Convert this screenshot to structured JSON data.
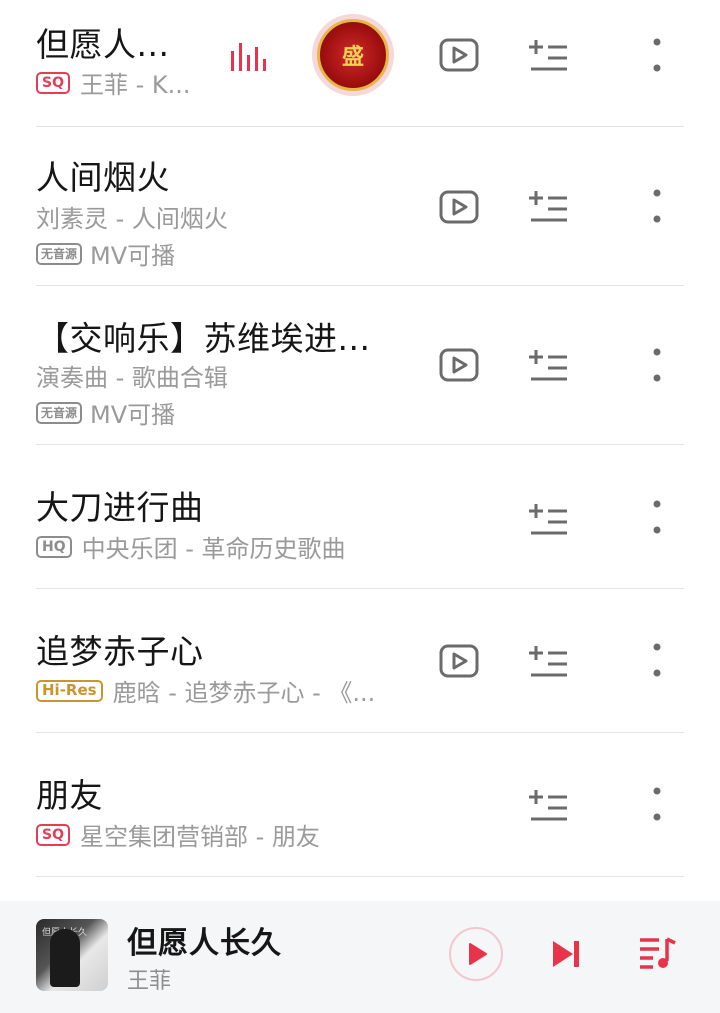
{
  "songs": [
    {
      "title": "但愿人...",
      "badge": "SQ",
      "badge_type": "sq",
      "subtitle": "王菲 - K...",
      "playing": true,
      "has_mv": true,
      "disc_char": "盛"
    },
    {
      "title": "人间烟火",
      "subtitle": "刘素灵 - 人间烟火",
      "no_source_badge": "无音源",
      "mv_text": "MV可播",
      "has_mv": true
    },
    {
      "title": "【交响乐】苏维埃进...",
      "subtitle": "演奏曲 - 歌曲合辑",
      "no_source_badge": "无音源",
      "mv_text": "MV可播",
      "has_mv": true
    },
    {
      "title": "大刀进行曲",
      "badge": "HQ",
      "badge_type": "hq",
      "subtitle": "中央乐团 - 革命历史歌曲",
      "has_mv": false
    },
    {
      "title": "追梦赤子心",
      "badge": "Hi-Res",
      "badge_type": "hires",
      "subtitle": "鹿晗 - 追梦赤子心 - 《...",
      "has_mv": true
    },
    {
      "title": "朋友",
      "badge": "SQ",
      "badge_type": "sq",
      "subtitle": "星空集团营销部 - 朋友",
      "has_mv": false
    }
  ],
  "player": {
    "title": "但愿人长久",
    "artist": "王菲",
    "cover_caption": "但愿人长久"
  },
  "colors": {
    "accent": "#e8334a",
    "text_primary": "#161616",
    "text_secondary": "#9a9a9a",
    "icon_gray": "#6b6b6b"
  },
  "icons": {
    "mv": "play-in-rect-icon",
    "add": "add-to-playlist-icon",
    "more": "vertical-dots-icon",
    "playing": "equalizer-icon",
    "play": "play-icon",
    "next": "skip-next-icon",
    "queue": "playlist-queue-icon"
  }
}
